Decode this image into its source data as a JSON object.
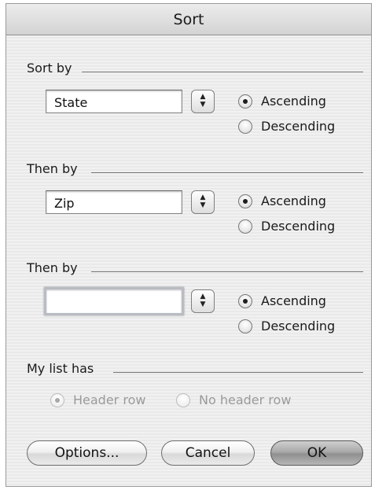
{
  "window": {
    "title": "Sort"
  },
  "sections": [
    {
      "label": "Sort by",
      "field_value": "State",
      "options": [
        "Ascending",
        "Descending"
      ],
      "selected": "Ascending"
    },
    {
      "label": "Then by",
      "field_value": "Zip",
      "options": [
        "Ascending",
        "Descending"
      ],
      "selected": "Ascending"
    },
    {
      "label": "Then by",
      "field_value": "",
      "options": [
        "Ascending",
        "Descending"
      ],
      "selected": "Ascending"
    }
  ],
  "list": {
    "label": "My list has",
    "options": [
      "Header row",
      "No header row"
    ],
    "selected": "Header row",
    "disabled": true
  },
  "buttons": {
    "options": "Options...",
    "cancel": "Cancel",
    "ok": "OK"
  },
  "icons": {
    "stepper": "up-down-arrows-icon",
    "radio_selected": "radio-selected-icon",
    "radio_unselected": "radio-unselected-icon"
  }
}
